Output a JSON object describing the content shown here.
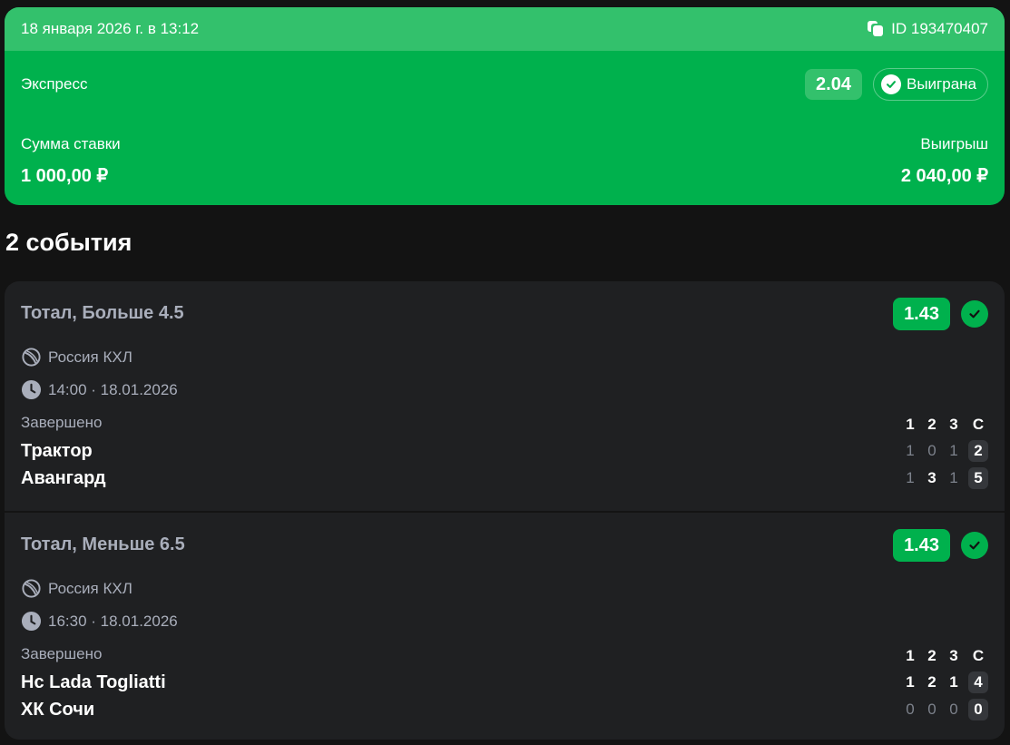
{
  "bet": {
    "datetime": "18 января 2026 г. в 13:12",
    "id_label": "ID 193470407",
    "type": "Экспресс",
    "total_odds": "2.04",
    "status": "Выиграна",
    "stake_label": "Сумма ставки",
    "stake_value": "1 000,00 ₽",
    "win_label": "Выигрыш",
    "win_value": "2 040,00 ₽",
    "colors": {
      "card": "#00b14d",
      "card_header": "#33c16c"
    }
  },
  "events_title": "2 события",
  "events": [
    {
      "market": "Тотал, Больше 4.5",
      "odds": "1.43",
      "league": "Россия КХЛ",
      "time": "14:00 · 18.01.2026",
      "status": "Завершено",
      "period_headers": [
        "1",
        "2",
        "3",
        "С"
      ],
      "teams": [
        {
          "name": "Трактор",
          "p1": "1",
          "p2": "0",
          "p3": "1",
          "total": "2",
          "lit": [
            false,
            false,
            false
          ]
        },
        {
          "name": "Авангард",
          "p1": "1",
          "p2": "3",
          "p3": "1",
          "total": "5",
          "lit": [
            false,
            true,
            false
          ]
        }
      ]
    },
    {
      "market": "Тотал, Меньше 6.5",
      "odds": "1.43",
      "league": "Россия КХЛ",
      "time": "16:30 · 18.01.2026",
      "status": "Завершено",
      "period_headers": [
        "1",
        "2",
        "3",
        "С"
      ],
      "teams": [
        {
          "name": "Hc Lada Togliatti",
          "p1": "1",
          "p2": "2",
          "p3": "1",
          "total": "4",
          "lit": [
            true,
            true,
            true
          ]
        },
        {
          "name": "ХК Сочи",
          "p1": "0",
          "p2": "0",
          "p3": "0",
          "total": "0",
          "lit": [
            false,
            false,
            false
          ]
        }
      ]
    }
  ],
  "icons": {
    "copy": "copy-icon",
    "check": "check-icon",
    "sport": "hockey-puck-icon",
    "time": "clock-icon"
  }
}
